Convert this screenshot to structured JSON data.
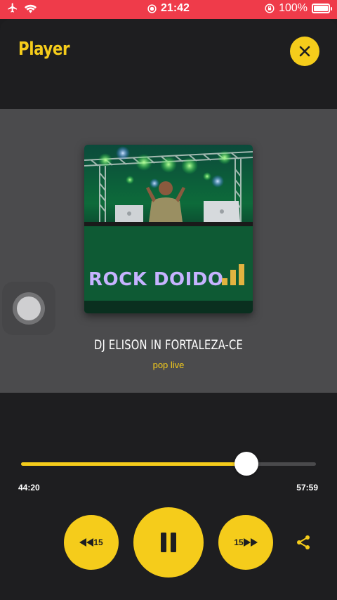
{
  "status_bar": {
    "time": "21:42",
    "battery": "100%",
    "battery_level": 1.0,
    "icons": [
      "airplane-icon",
      "wifi-icon",
      "screen-record-icon",
      "orientation-lock-icon",
      "battery-icon"
    ]
  },
  "header": {
    "title": "Player",
    "close_icon": "close-icon"
  },
  "cover": {
    "banner_text": "ROCK DOIDO"
  },
  "track": {
    "title": "DJ ELISON IN FORTALEZA-CE",
    "subtitle": "pop live"
  },
  "progress": {
    "elapsed": "44:20",
    "total": "57:59",
    "fraction": 0.7645
  },
  "controls": {
    "rewind_label": "15",
    "forward_label": "15",
    "play_state": "pause-icon",
    "share_icon": "share-icon"
  },
  "colors": {
    "accent": "#f5cc1b",
    "status_bar": "#ef3b4a",
    "background": "#1e1e20",
    "panel": "#4b4b4d"
  }
}
